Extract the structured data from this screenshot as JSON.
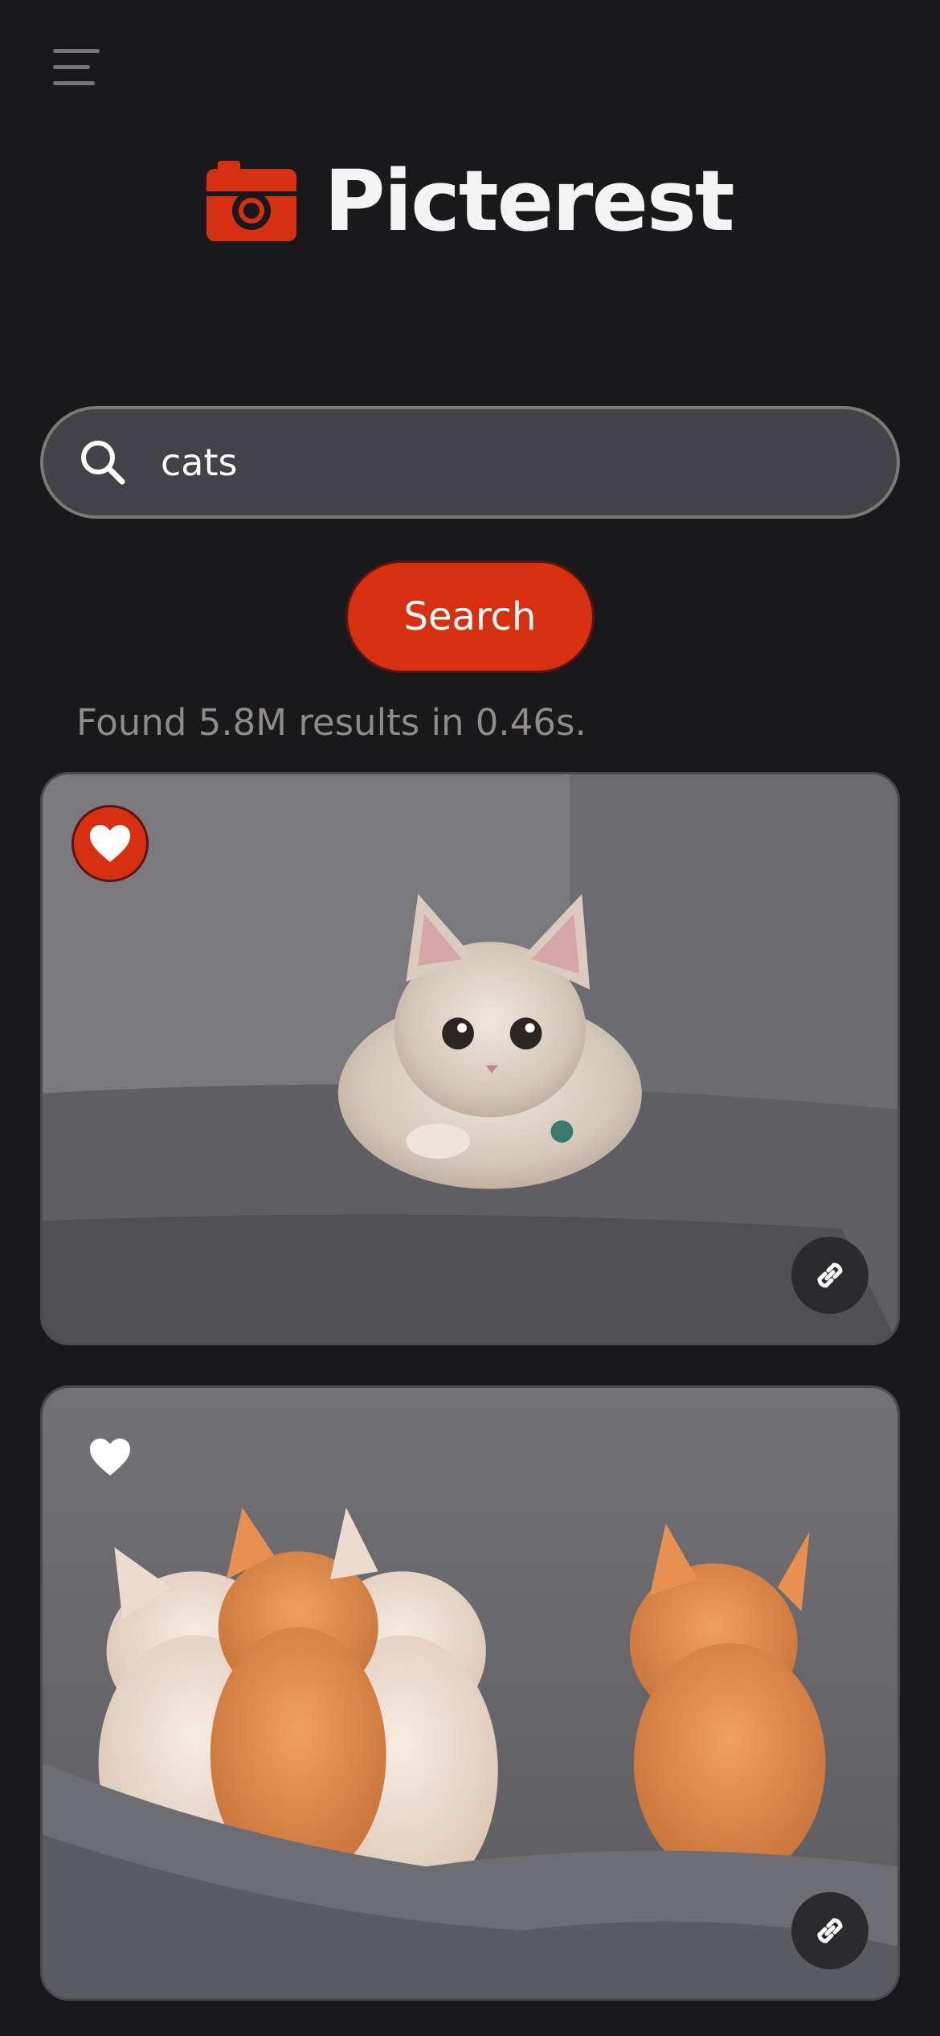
{
  "header": {
    "menu_icon": "hamburger-menu-icon",
    "brand_icon": "camera-icon",
    "brand_name": "Picterest"
  },
  "search": {
    "value": "cats",
    "icon": "search-icon",
    "button_label": "Search"
  },
  "results": {
    "summary": "Found 5.8M results in 0.46s.",
    "items": [
      {
        "image": "kitten crouching on grey sofa",
        "favorited": true,
        "favorite_icon": "heart-icon",
        "link_icon": "link-icon"
      },
      {
        "image": "four kittens sleeping under a grey blanket",
        "favorited": false,
        "favorite_icon": "heart-icon",
        "link_icon": "link-icon"
      }
    ]
  },
  "colors": {
    "background": "#19181b",
    "accent": "#d63011",
    "search_field": "#434248",
    "muted_text": "#8e8b88"
  }
}
